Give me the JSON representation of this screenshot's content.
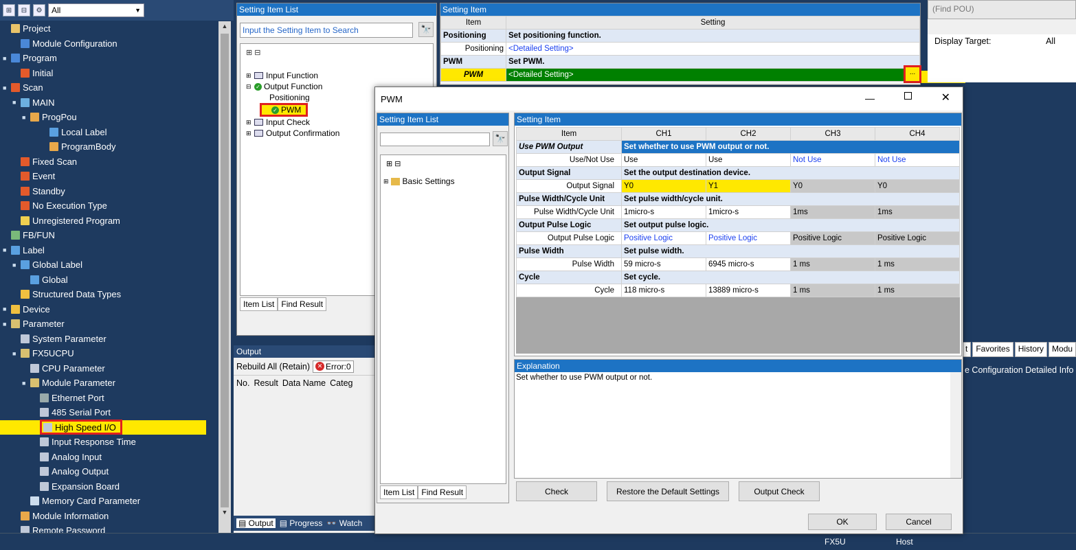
{
  "nav": {
    "filter": "All",
    "items": [
      {
        "label": "Project",
        "depth": 0,
        "icon": "project-icon",
        "exp": ""
      },
      {
        "label": "Module Configuration",
        "depth": 1,
        "icon": "module-config-icon",
        "exp": ""
      },
      {
        "label": "Program",
        "depth": 0,
        "icon": "program-icon",
        "exp": "■"
      },
      {
        "label": "Initial",
        "depth": 1,
        "icon": "program-type-icon",
        "exp": ""
      },
      {
        "label": "Scan",
        "depth": 0,
        "icon": "program-type-icon",
        "exp": "■"
      },
      {
        "label": "MAIN",
        "depth": 1,
        "icon": "task-icon",
        "exp": "■"
      },
      {
        "label": "ProgPou",
        "depth": 2,
        "icon": "pou-icon",
        "exp": "■"
      },
      {
        "label": "Local Label",
        "depth": 4,
        "icon": "label-icon",
        "exp": ""
      },
      {
        "label": "ProgramBody",
        "depth": 4,
        "icon": "program-body-icon",
        "exp": ""
      },
      {
        "label": "Fixed Scan",
        "depth": 1,
        "icon": "program-type-icon",
        "exp": ""
      },
      {
        "label": "Event",
        "depth": 1,
        "icon": "program-type-icon",
        "exp": ""
      },
      {
        "label": "Standby",
        "depth": 1,
        "icon": "program-type-icon",
        "exp": ""
      },
      {
        "label": "No Execution Type",
        "depth": 1,
        "icon": "program-type-icon",
        "exp": ""
      },
      {
        "label": "Unregistered Program",
        "depth": 1,
        "icon": "unregistered-icon",
        "exp": ""
      },
      {
        "label": "FB/FUN",
        "depth": 0,
        "icon": "fbfun-icon",
        "exp": ""
      },
      {
        "label": "Label",
        "depth": 0,
        "icon": "label-folder-icon",
        "exp": "■"
      },
      {
        "label": "Global Label",
        "depth": 1,
        "icon": "label-folder-icon",
        "exp": "■"
      },
      {
        "label": "Global",
        "depth": 2,
        "icon": "label-icon",
        "exp": ""
      },
      {
        "label": "Structured Data Types",
        "depth": 1,
        "icon": "struct-icon",
        "exp": ""
      },
      {
        "label": "Device",
        "depth": 0,
        "icon": "device-icon",
        "exp": "■"
      },
      {
        "label": "Parameter",
        "depth": 0,
        "icon": "parameter-icon",
        "exp": "■"
      },
      {
        "label": "System Parameter",
        "depth": 1,
        "icon": "param-item-icon",
        "exp": ""
      },
      {
        "label": "FX5UCPU",
        "depth": 1,
        "icon": "parameter-icon",
        "exp": "■"
      },
      {
        "label": "CPU Parameter",
        "depth": 2,
        "icon": "param-item-icon",
        "exp": ""
      },
      {
        "label": "Module Parameter",
        "depth": 2,
        "icon": "parameter-icon",
        "exp": "■"
      },
      {
        "label": "Ethernet Port",
        "depth": 3,
        "icon": "ethernet-icon",
        "exp": ""
      },
      {
        "label": "485 Serial Port",
        "depth": 3,
        "icon": "param-item-icon",
        "exp": ""
      },
      {
        "label": "High Speed I/O",
        "depth": 3,
        "icon": "param-item-icon",
        "exp": "",
        "highlight": true
      },
      {
        "label": "Input Response Time",
        "depth": 3,
        "icon": "param-item-icon",
        "exp": ""
      },
      {
        "label": "Analog Input",
        "depth": 3,
        "icon": "param-item-icon",
        "exp": ""
      },
      {
        "label": "Analog Output",
        "depth": 3,
        "icon": "param-item-icon",
        "exp": ""
      },
      {
        "label": "Expansion Board",
        "depth": 3,
        "icon": "param-item-icon",
        "exp": ""
      },
      {
        "label": "Memory Card Parameter",
        "depth": 2,
        "icon": "memory-card-icon",
        "exp": ""
      },
      {
        "label": "Module Information",
        "depth": 1,
        "icon": "module-info-icon",
        "exp": ""
      },
      {
        "label": "Remote Password",
        "depth": 1,
        "icon": "param-item-icon",
        "exp": ""
      }
    ]
  },
  "sil": {
    "title": "Setting Item List",
    "search_placeholder": "Input the Setting Item to Search",
    "tree": [
      {
        "label": "Input Function",
        "depth": 0,
        "exp": "⊞"
      },
      {
        "label": "Output Function",
        "depth": 0,
        "exp": "⊟",
        "check": true
      },
      {
        "label": "Positioning",
        "depth": 1,
        "exp": ""
      },
      {
        "label": "PWM",
        "depth": 1,
        "exp": "",
        "check": true,
        "highlight": true
      },
      {
        "label": "Input Check",
        "depth": 0,
        "exp": "⊞"
      },
      {
        "label": "Output Confirmation",
        "depth": 0,
        "exp": "⊞"
      }
    ],
    "tabs": [
      "Item List",
      "Find Result"
    ]
  },
  "si": {
    "title": "Setting Item",
    "col_item": "Item",
    "col_setting": "Setting",
    "rows": [
      {
        "item": "Positioning",
        "setting": "Set positioning function.",
        "group": true
      },
      {
        "item": "Positioning",
        "setting": "<Detailed Setting>",
        "group": false
      },
      {
        "item": "PWM",
        "setting": "Set PWM.",
        "group": true
      },
      {
        "item": "PWM",
        "setting": "<Detailed Setting>",
        "group": false,
        "selected": true
      }
    ],
    "ellipsis": "..."
  },
  "output": {
    "title": "Output",
    "rebuild": "Rebuild All (Retain)",
    "error": "Error:0",
    "cols": [
      "No.",
      "Result",
      "Data Name",
      "Categ"
    ],
    "tabs": [
      "Output",
      "Progress",
      "Watch"
    ]
  },
  "right": {
    "find_placeholder": "(Find POU)",
    "display_target_label": "Display Target:",
    "display_target_value": "All",
    "tabs": [
      "t",
      "Favorites",
      "History",
      "Modu"
    ],
    "info": "e Configuration Detailed Info"
  },
  "status": {
    "items": [
      "FX5U",
      "Host"
    ]
  },
  "dlg": {
    "title": "PWM",
    "sil_title": "Setting Item List",
    "si_title": "Setting Item",
    "tree": [
      "Basic Settings"
    ],
    "tabs": [
      "Item List",
      "Find Result"
    ],
    "cols": [
      "Item",
      "CH1",
      "CH2",
      "CH3",
      "CH4"
    ],
    "groups": [
      {
        "name": "Use PWM Output",
        "desc": "Set whether to use PWM output or not.",
        "selected": true,
        "sub": "Use/Not Use",
        "vals": [
          "Use",
          "Use",
          "Not Use",
          "Not Use"
        ],
        "blue": [
          false,
          false,
          true,
          true
        ],
        "gray": [
          false,
          false,
          false,
          false
        ],
        "yellow": [
          false,
          false,
          false,
          false
        ]
      },
      {
        "name": "Output Signal",
        "desc": "Set the output destination device.",
        "sub": "Output Signal",
        "vals": [
          "Y0",
          "Y1",
          "Y0",
          "Y0"
        ],
        "blue": [
          false,
          false,
          false,
          false
        ],
        "gray": [
          false,
          false,
          true,
          true
        ],
        "yellow": [
          true,
          true,
          false,
          false
        ]
      },
      {
        "name": "Pulse Width/Cycle Unit",
        "desc": "Set pulse width/cycle unit.",
        "sub": "Pulse Width/Cycle Unit",
        "vals": [
          "1micro-s",
          "1micro-s",
          "1ms",
          "1ms"
        ],
        "blue": [
          false,
          false,
          false,
          false
        ],
        "gray": [
          false,
          false,
          true,
          true
        ],
        "yellow": [
          false,
          false,
          false,
          false
        ]
      },
      {
        "name": "Output Pulse Logic",
        "desc": "Set output pulse logic.",
        "sub": "Output Pulse Logic",
        "vals": [
          "Positive Logic",
          "Positive Logic",
          "Positive Logic",
          "Positive Logic"
        ],
        "blue": [
          true,
          true,
          false,
          false
        ],
        "gray": [
          false,
          false,
          true,
          true
        ],
        "yellow": [
          false,
          false,
          false,
          false
        ]
      },
      {
        "name": "Pulse Width",
        "desc": "Set pulse width.",
        "sub": "Pulse Width",
        "vals": [
          "59 micro-s",
          "6945 micro-s",
          "1 ms",
          "1 ms"
        ],
        "blue": [
          false,
          false,
          false,
          false
        ],
        "gray": [
          false,
          false,
          true,
          true
        ],
        "yellow": [
          false,
          false,
          false,
          false
        ]
      },
      {
        "name": "Cycle",
        "desc": "Set cycle.",
        "sub": "Cycle",
        "vals": [
          "118 micro-s",
          "13889 micro-s",
          "1 ms",
          "1 ms"
        ],
        "blue": [
          false,
          false,
          false,
          false
        ],
        "gray": [
          false,
          false,
          true,
          true
        ],
        "yellow": [
          false,
          false,
          false,
          false
        ]
      }
    ],
    "explanation_title": "Explanation",
    "explanation": "Set whether to use PWM output or not.",
    "btn_check": "Check",
    "btn_restore": "Restore the Default Settings",
    "btn_output_check": "Output Check",
    "btn_ok": "OK",
    "btn_cancel": "Cancel"
  },
  "colors": {
    "accent": "#1d73c4",
    "highlight": "#ffe800",
    "selected_row": "#008000",
    "red": "#e02020"
  }
}
